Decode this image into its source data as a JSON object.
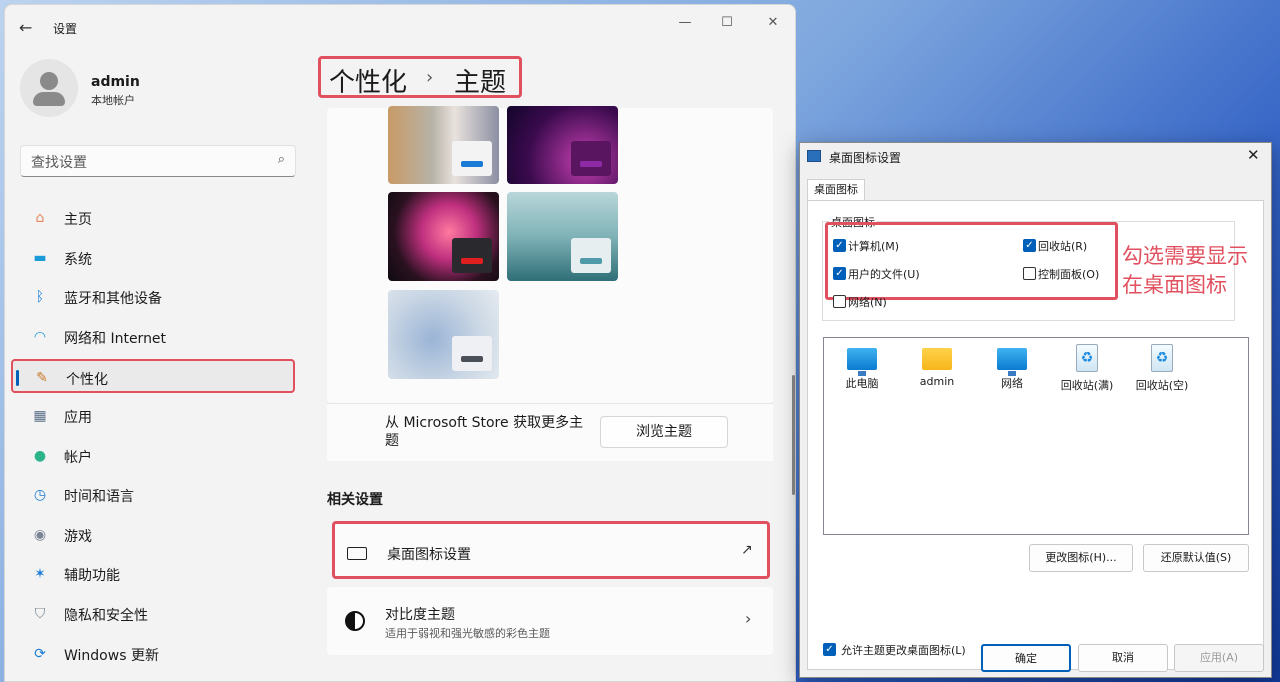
{
  "settings": {
    "title": "设置",
    "user": {
      "name": "admin",
      "type": "本地帐户"
    },
    "search_placeholder": "查找设置",
    "nav": [
      {
        "label": "主页",
        "icon": "home-icon",
        "glyph": "⌂",
        "color": "#e8835a"
      },
      {
        "label": "系统",
        "icon": "system-icon",
        "glyph": "▬",
        "color": "#1a9bd7"
      },
      {
        "label": "蓝牙和其他设备",
        "icon": "bluetooth-icon",
        "glyph": "ᛒ",
        "color": "#1a7bd7"
      },
      {
        "label": "网络和 Internet",
        "icon": "wifi-icon",
        "glyph": "◠",
        "color": "#1a9bd7"
      },
      {
        "label": "个性化",
        "icon": "brush-icon",
        "glyph": "✎",
        "color": "#c77b2a"
      },
      {
        "label": "应用",
        "icon": "apps-icon",
        "glyph": "▦",
        "color": "#5b6f8a"
      },
      {
        "label": "帐户",
        "icon": "account-icon",
        "glyph": "●",
        "color": "#2bb38a"
      },
      {
        "label": "时间和语言",
        "icon": "globe-clock-icon",
        "glyph": "◷",
        "color": "#1a7bd7"
      },
      {
        "label": "游戏",
        "icon": "gamepad-icon",
        "glyph": "◉",
        "color": "#7a8594"
      },
      {
        "label": "辅助功能",
        "icon": "accessibility-icon",
        "glyph": "✶",
        "color": "#1a7bd7"
      },
      {
        "label": "隐私和安全性",
        "icon": "shield-icon",
        "glyph": "⛉",
        "color": "#7a8594"
      },
      {
        "label": "Windows 更新",
        "icon": "update-icon",
        "glyph": "⟳",
        "color": "#1a7bd7"
      }
    ],
    "selected_nav": "个性化",
    "breadcrumb": {
      "parent": "个性化",
      "separator": "›",
      "current": "主题"
    },
    "store": {
      "text": "从 Microsoft Store 获取更多主题",
      "button": "浏览主题"
    },
    "related_title": "相关设置",
    "desktop_icon_settings": "桌面图标设置",
    "contrast": {
      "title": "对比度主题",
      "subtitle": "适用于弱视和强光敏感的彩色主题"
    }
  },
  "dialog": {
    "title": "桌面图标设置",
    "tab": "桌面图标",
    "group_label": "桌面图标",
    "checkboxes": [
      {
        "label": "计算机(M)",
        "checked": true
      },
      {
        "label": "回收站(R)",
        "checked": true
      },
      {
        "label": "用户的文件(U)",
        "checked": true
      },
      {
        "label": "控制面板(O)",
        "checked": false
      },
      {
        "label": "网络(N)",
        "checked": false
      }
    ],
    "icons": [
      {
        "label": "此电脑",
        "kind": "monitor"
      },
      {
        "label": "admin",
        "kind": "folder"
      },
      {
        "label": "网络",
        "kind": "network"
      },
      {
        "label": "回收站(满)",
        "kind": "bin-full"
      },
      {
        "label": "回收站(空)",
        "kind": "bin-empty"
      }
    ],
    "change_icon": "更改图标(H)...",
    "restore_default": "还原默认值(S)",
    "allow_themes": {
      "label": "允许主题更改桌面图标(L)",
      "checked": true
    },
    "ok": "确定",
    "cancel": "取消",
    "apply": "应用(A)"
  },
  "annotation": {
    "line1": "勾选需要显示",
    "line2": "在桌面图标"
  },
  "colors": {
    "accent": "#005fb8",
    "highlight": "#e0505e"
  }
}
